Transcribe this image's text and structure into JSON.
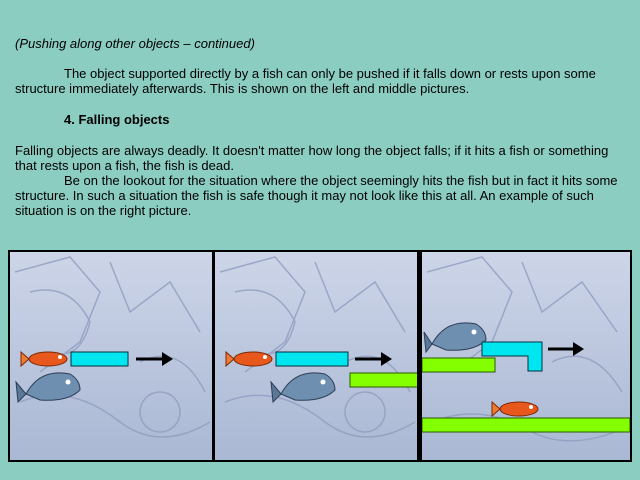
{
  "subtitle": "(Pushing along other objects – continued)",
  "paragraph1": "The object supported directly by a fish can only be pushed if it falls down or rests upon some structure immediately afterwards. This is shown on the left and middle pictures.",
  "heading": "4. Falling objects",
  "paragraph2a": "Falling objects are always deadly. It doesn't matter how long the object falls; if it hits a fish or something that rests upon a fish, the fish is dead.",
  "paragraph2b": "Be on the lookout for the situation where the object seemingly hits the fish but in fact it hits some structure. In such a situation the fish is safe though it may not look like this at all. An example of such situation is on the right picture.",
  "colors": {
    "background": "#8ccdc2",
    "steel_pipe": "#00e6f0",
    "green_platform": "#84ff00",
    "small_fish": "#e8581c",
    "big_fish": "#6f8fb0",
    "arrow": "#000000"
  },
  "panels": [
    {
      "name": "left",
      "icons": [
        "small-fish",
        "cyan-block",
        "push-arrow",
        "big-fish"
      ]
    },
    {
      "name": "middle",
      "icons": [
        "small-fish",
        "cyan-block",
        "push-arrow",
        "big-fish",
        "green-platform"
      ]
    },
    {
      "name": "right",
      "icons": [
        "big-fish",
        "cyan-l-block",
        "push-arrow",
        "green-platform",
        "small-fish",
        "green-floor"
      ]
    }
  ]
}
